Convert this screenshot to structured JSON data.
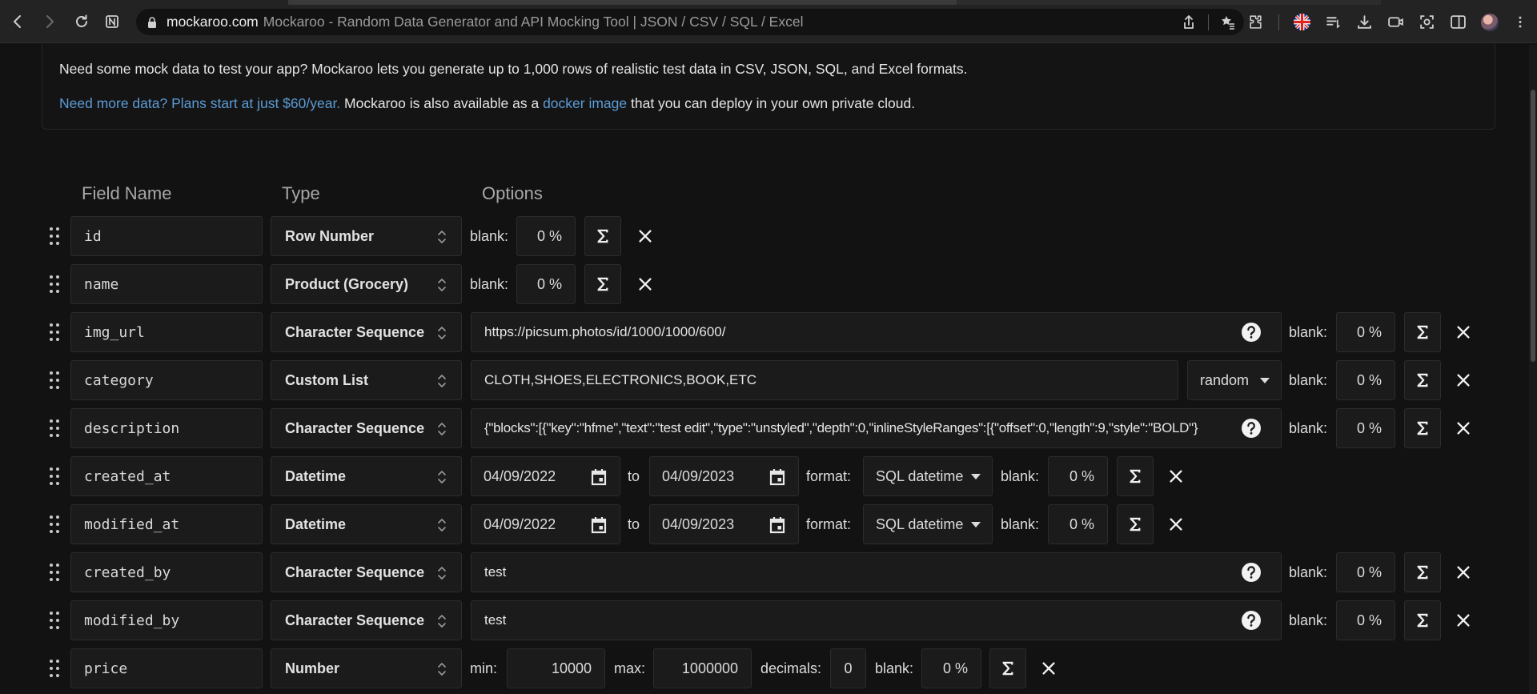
{
  "browser": {
    "domain": "mockaroo.com",
    "page_title": "Mockaroo - Random Data Generator and API Mocking Tool | JSON / CSV / SQL / Excel"
  },
  "info": {
    "line1": "Need some mock data to test your app? Mockaroo lets you generate up to 1,000 rows of realistic test data in CSV, JSON, SQL, and Excel formats.",
    "plans_link": "Need more data? Plans start at just $60/year.",
    "line2_mid": " Mockaroo is also available as a ",
    "docker_link": "docker image",
    "line2_end": " that you can deploy in your own private cloud."
  },
  "columns": {
    "field_name": "Field Name",
    "type": "Type",
    "options": "Options"
  },
  "labels": {
    "blank": "blank:",
    "to": "to",
    "format": "format:",
    "min": "min:",
    "max": "max:",
    "decimals": "decimals:"
  },
  "fields": [
    {
      "name": "id",
      "type": "Row Number",
      "blank": "0 %"
    },
    {
      "name": "name",
      "type": "Product (Grocery)",
      "blank": "0 %"
    },
    {
      "name": "img_url",
      "type": "Character Sequence",
      "value": "https://picsum.photos/id/1000/1000/600/",
      "blank": "0 %"
    },
    {
      "name": "category",
      "type": "Custom List",
      "value": "CLOTH,SHOES,ELECTRONICS,BOOK,ETC",
      "order": "random",
      "blank": "0 %"
    },
    {
      "name": "description",
      "type": "Character Sequence",
      "value": "{\"blocks\":[{\"key\":\"hfme\",\"text\":\"test edit\",\"type\":\"unstyled\",\"depth\":0,\"inlineStyleRanges\":[{\"offset\":0,\"length\":9,\"style\":\"BOLD\"}",
      "blank": "0 %"
    },
    {
      "name": "created_at",
      "type": "Datetime",
      "from": "04/09/2022",
      "to": "04/09/2023",
      "format": "SQL datetime",
      "blank": "0 %"
    },
    {
      "name": "modified_at",
      "type": "Datetime",
      "from": "04/09/2022",
      "to": "04/09/2023",
      "format": "SQL datetime",
      "blank": "0 %"
    },
    {
      "name": "created_by",
      "type": "Character Sequence",
      "value": "test",
      "blank": "0 %"
    },
    {
      "name": "modified_by",
      "type": "Character Sequence",
      "value": "test",
      "blank": "0 %"
    },
    {
      "name": "price",
      "type": "Number",
      "min": "10000",
      "max": "1000000",
      "decimals": "0",
      "blank": "0 %"
    }
  ]
}
